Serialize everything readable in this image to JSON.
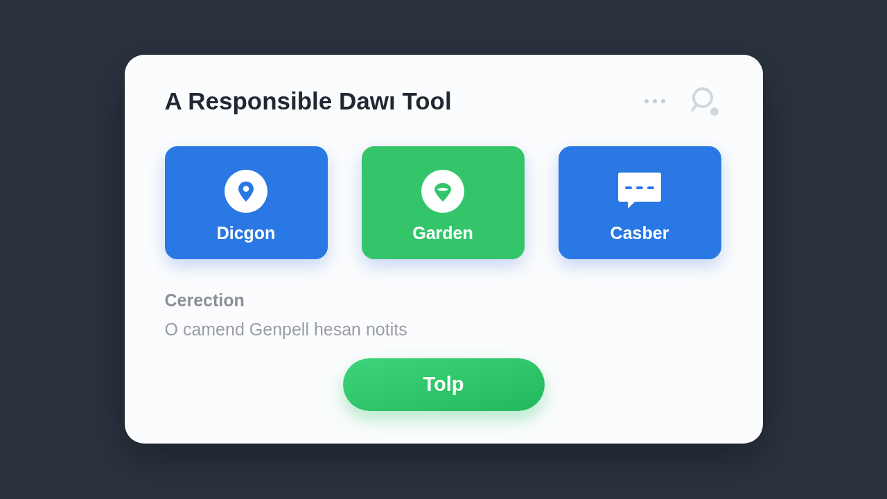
{
  "card": {
    "title": "A Responsible Dawı Tool",
    "tiles": [
      {
        "label": "Dicgon",
        "kind": "pin",
        "color": "#2a78e4"
      },
      {
        "label": "Garden",
        "kind": "leaf-pin",
        "color": "#34c56b"
      },
      {
        "label": "Casber",
        "kind": "chat",
        "color": "#2a78e4"
      }
    ],
    "section": {
      "heading": "Cerection",
      "text": "O camend Genpell hesan notits"
    },
    "button": "Tolp"
  }
}
